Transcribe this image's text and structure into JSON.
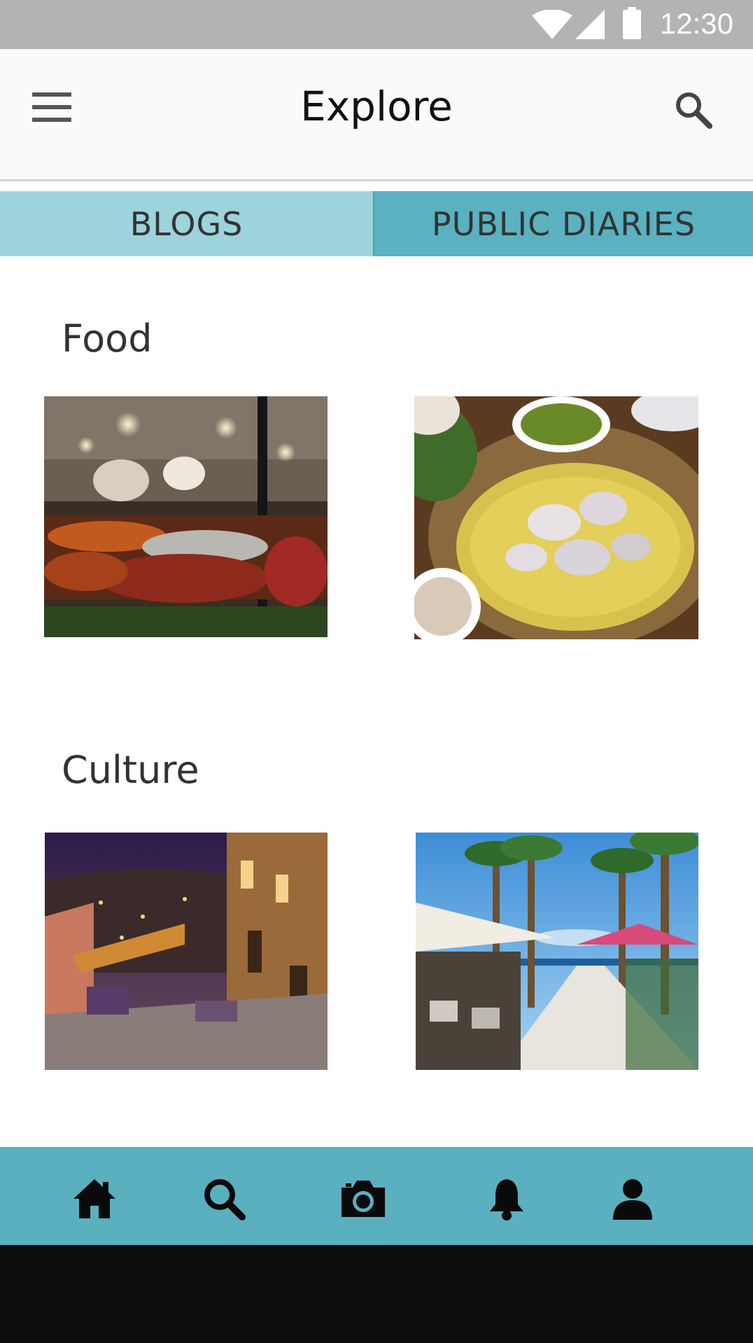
{
  "status_bar": {
    "time": "12:30",
    "icons": [
      "wifi-icon",
      "signal-icon",
      "battery-icon"
    ]
  },
  "app_bar": {
    "title": "Explore",
    "left_icon": "menu-icon",
    "right_icon": "search-icon"
  },
  "tabs": [
    {
      "label": "BLOGS",
      "selected": false
    },
    {
      "label": "PUBLIC DIARIES",
      "selected": true
    }
  ],
  "sections": [
    {
      "title": "Food",
      "images": [
        "night-market-food-photo",
        "rice-and-meat-platter-photo"
      ]
    },
    {
      "title": "Culture",
      "images": [
        "old-town-stairway-at-night-photo",
        "palm-promenade-cafes-photo"
      ]
    }
  ],
  "bottom_nav": [
    "home-icon",
    "search-icon",
    "camera-icon",
    "bell-icon",
    "profile-icon"
  ],
  "colors": {
    "tab_light": "#9dd3db",
    "tab_dark": "#5ab1bf",
    "bottom_nav": "#5ab0bf",
    "status_bar": "#b3b3b3"
  }
}
